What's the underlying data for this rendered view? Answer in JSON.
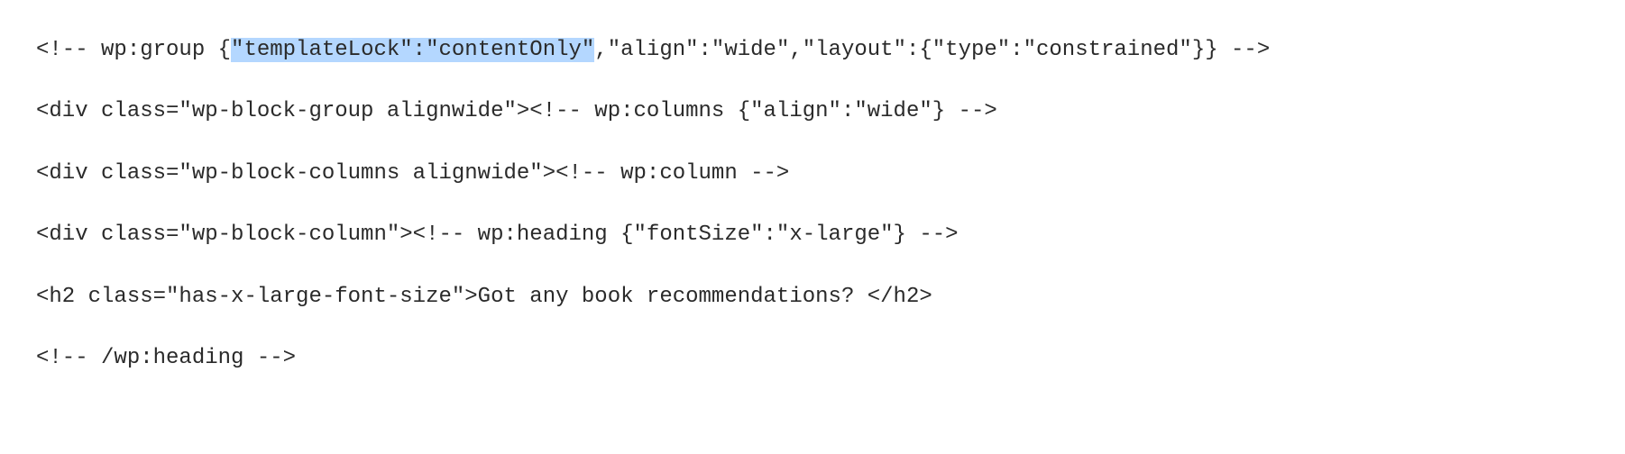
{
  "code": {
    "line1": {
      "a": "<!-- wp:group {",
      "hl": "\"templateLock\":\"contentOnly\"",
      "b": ",\"align\":\"wide\",\"layout\":{\"type\":\"constrained\"}} -->"
    },
    "line2": "<div class=\"wp-block-group alignwide\"><!-- wp:columns {\"align\":\"wide\"} -->",
    "line3": "<div class=\"wp-block-columns alignwide\"><!-- wp:column -->",
    "line4": "<div class=\"wp-block-column\"><!-- wp:heading {\"fontSize\":\"x-large\"} -->",
    "line5": "<h2 class=\"has-x-large-font-size\">Got any book recommendations? </h2>",
    "line6": "<!-- /wp:heading -->"
  }
}
